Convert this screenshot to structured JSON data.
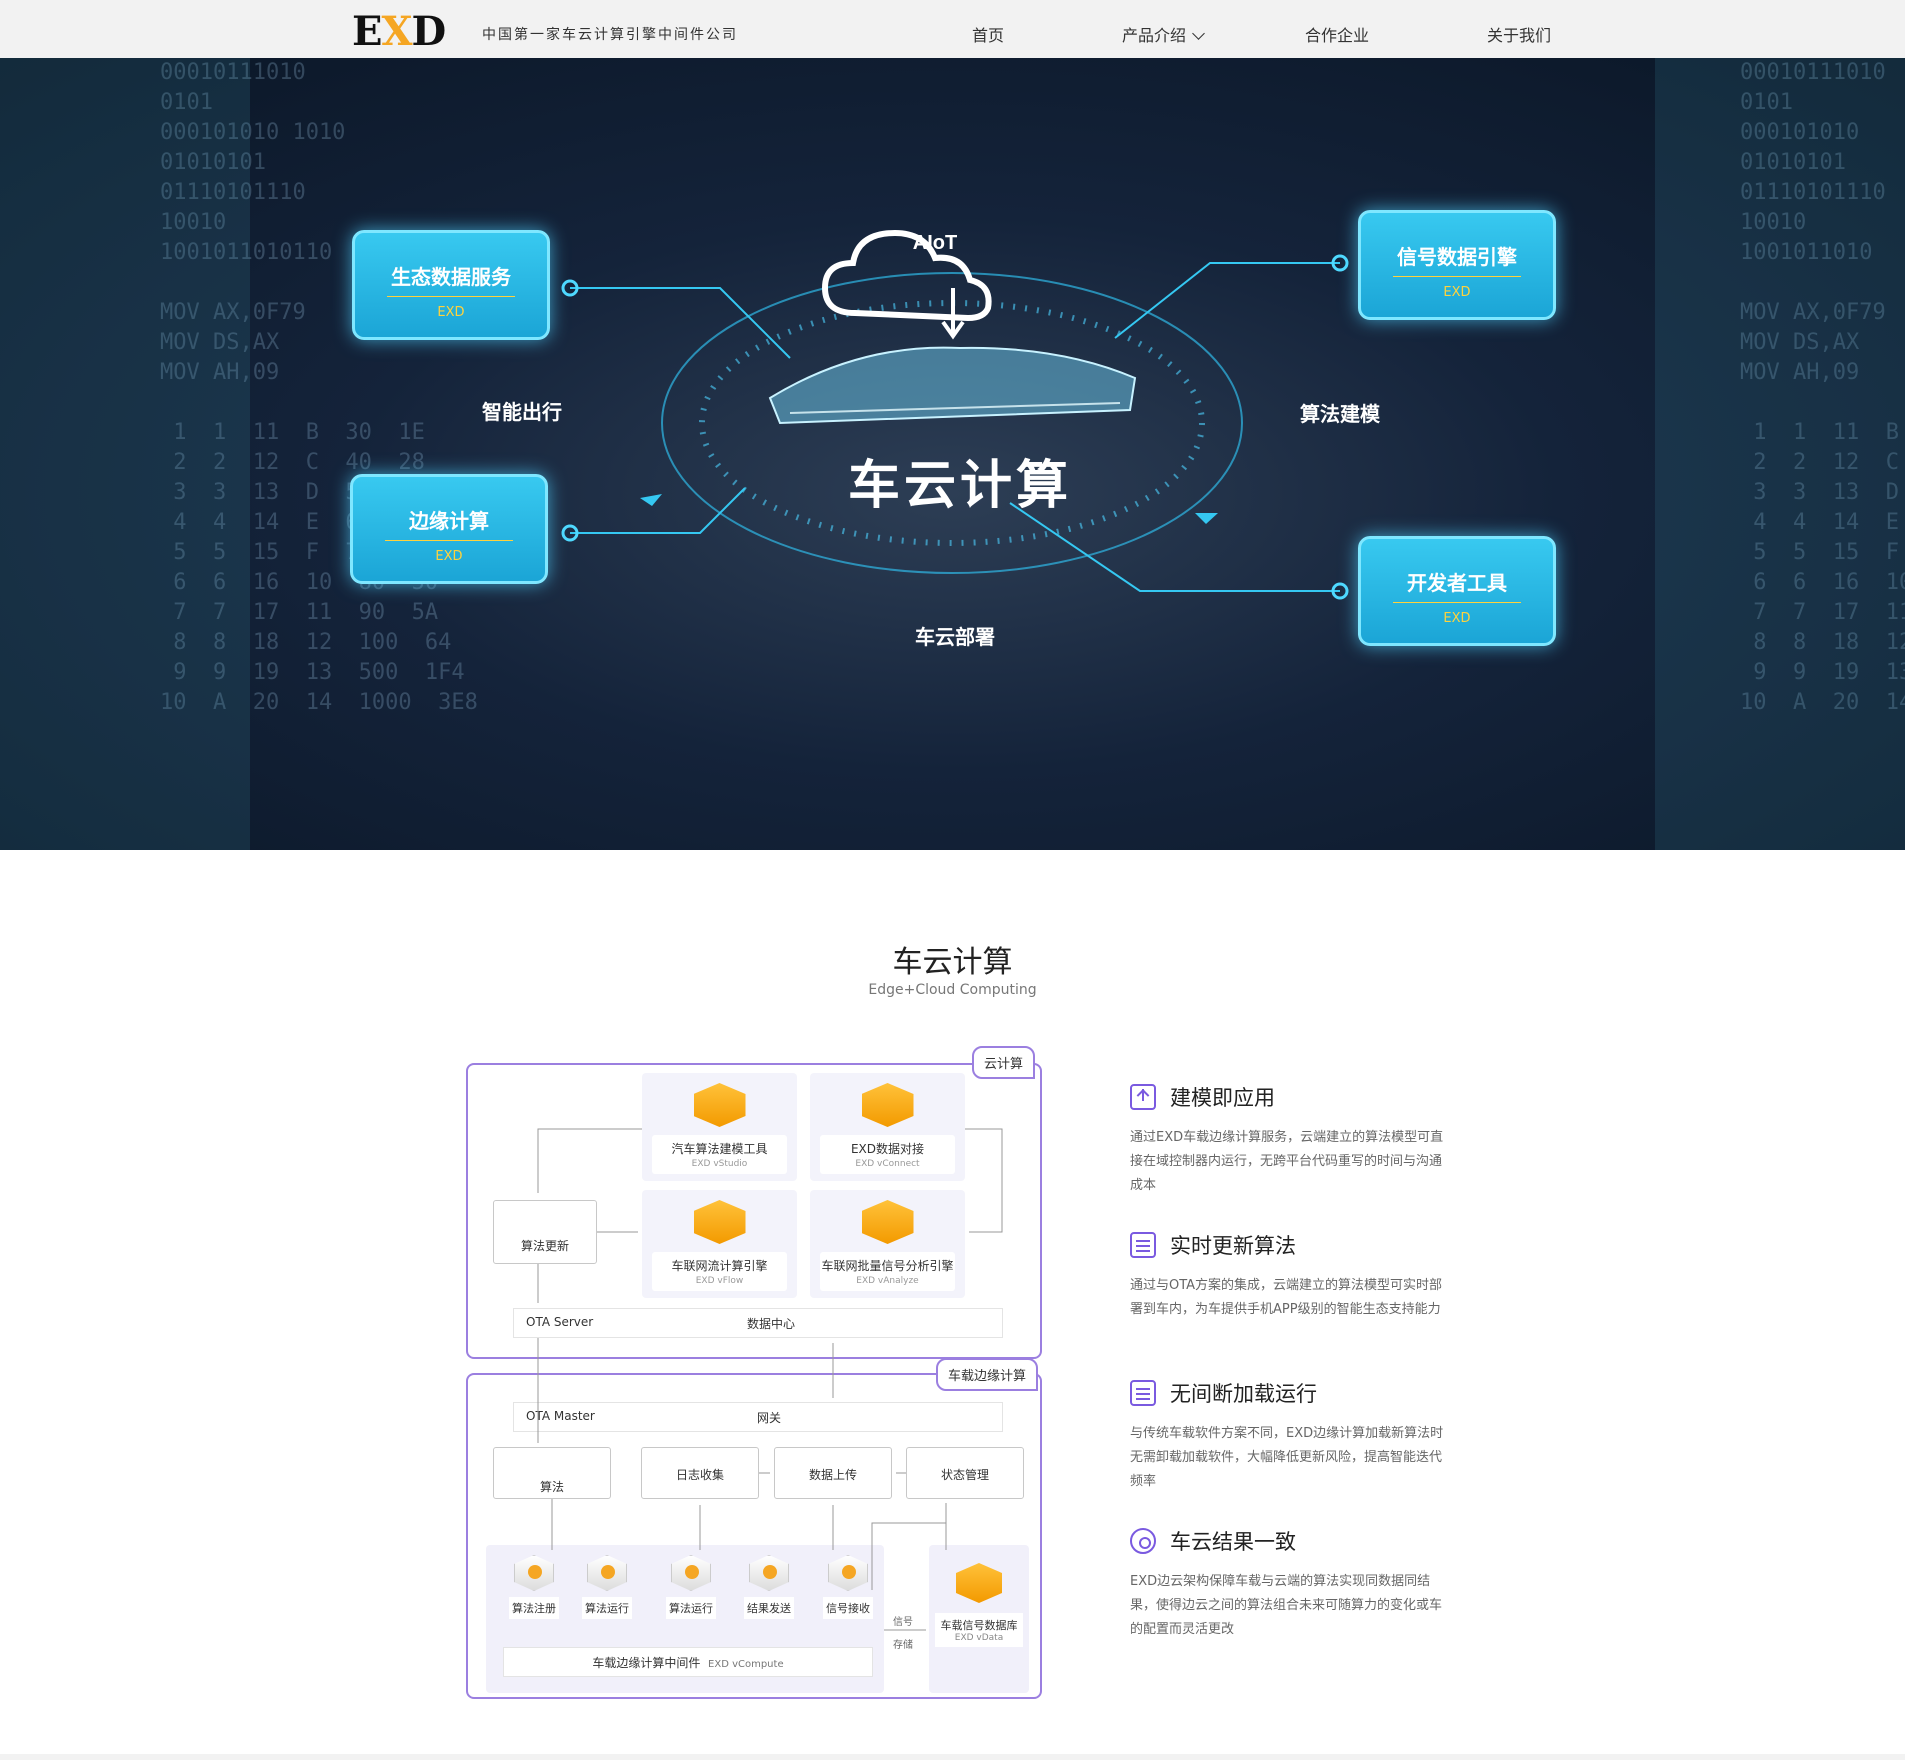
{
  "header": {
    "logo_e": "E",
    "logo_x": "X",
    "logo_d": "D",
    "tagline": "中国第一家车云计算引擎中间件公司",
    "nav": [
      "首页",
      "产品介绍",
      "合作企业",
      "关于我们"
    ]
  },
  "hero": {
    "cloud_label": "AIoT",
    "center_title": "车云计算",
    "boxes": [
      {
        "title": "生态数据服务",
        "sub": "EXD"
      },
      {
        "title": "边缘计算",
        "sub": "EXD"
      },
      {
        "title": "信号数据引擎",
        "sub": "EXD"
      },
      {
        "title": "开发者工具",
        "sub": "EXD"
      }
    ],
    "labels": [
      "智能出行",
      "算法建模",
      "车云部署"
    ]
  },
  "section": {
    "title": "车云计算",
    "subtitle": "Edge+Cloud Computing"
  },
  "diagram": {
    "cloud_tag": "云计算",
    "edge_tag": "车载边缘计算",
    "tiles": [
      {
        "label": "汽车算法建模工具",
        "sub": "EXD vStudio"
      },
      {
        "label": "EXD数据对接",
        "sub": "EXD vConnect"
      },
      {
        "label": "车联网流计算引擎",
        "sub": "EXD vFlow"
      },
      {
        "label": "车联网批量信号分析引擎",
        "sub": "EXD vAnalyze"
      }
    ],
    "algo_update": "算法更新",
    "ota_server": "OTA Server",
    "data_center": "数据中心",
    "ota_master": "OTA Master",
    "gateway": "网关",
    "algo": "算法",
    "log_collect": "日志收集",
    "data_upload": "数据上传",
    "state_mgmt": "状态管理",
    "minis": [
      "算法注册",
      "算法运行",
      "算法运行",
      "结果发送",
      "信号接收"
    ],
    "signal_store_1": "信号",
    "signal_store_2": "存储",
    "vdata_label": "车载信号数据库",
    "vdata_sub": "EXD vData",
    "middleware": "车载边缘计算中间件",
    "middleware_sub": "EXD vCompute"
  },
  "features": [
    {
      "title": "建模即应用",
      "desc": "通过EXD车载边缘计算服务，云端建立的算法模型可直接在域控制器内运行，无跨平台代码重写的时间与沟通成本",
      "icon": "upload-icon"
    },
    {
      "title": "实时更新算法",
      "desc": "通过与OTA方案的集成，云端建立的算法模型可实时部署到车内，为车提供手机APP级别的智能生态支持能力",
      "icon": "edit-doc-icon"
    },
    {
      "title": "无间断加载运行",
      "desc": "与传统车载软件方案不同，EXD边缘计算加载新算法时无需卸载加载软件，大幅降低更新风险，提高智能迭代频率",
      "icon": "list-doc-icon"
    },
    {
      "title": "车云结果一致",
      "desc": "EXD边云架构保障车载与云端的算法实现同数据同结果，使得边云之间的算法组合未来可随算力的变化或车的配置而灵活更改",
      "icon": "gear-icon"
    }
  ]
}
